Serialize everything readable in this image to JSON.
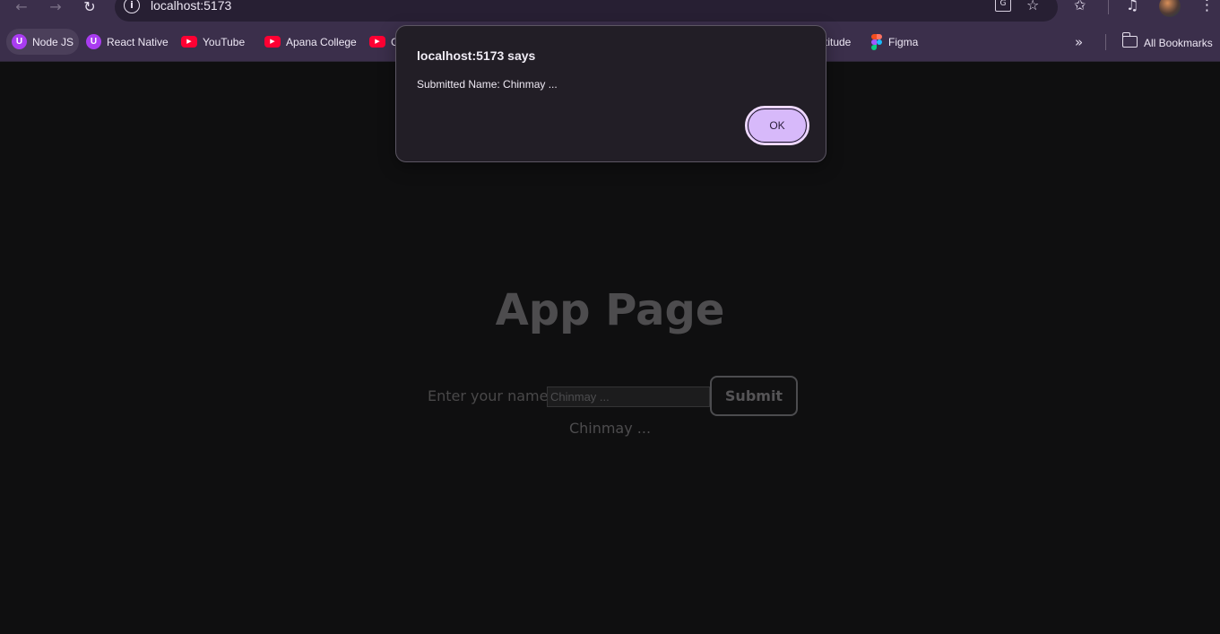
{
  "browser": {
    "url": "localhost:5173",
    "nav": {
      "back_icon": "←",
      "forward_icon": "→",
      "reload_icon": "↻"
    },
    "icons": {
      "site_info": "i",
      "translate": "G",
      "star": "☆",
      "side_star": "✩",
      "media": "♫",
      "menu": "⋮"
    }
  },
  "bookmarks": {
    "items": [
      {
        "label": "Node JS",
        "icon": "udemy-icon"
      },
      {
        "label": "React Native",
        "icon": "udemy-icon"
      },
      {
        "label": "YouTube",
        "icon": "youtube-icon"
      },
      {
        "label": "Apana College",
        "icon": "youtube-icon"
      },
      {
        "label": "C",
        "icon": "youtube-icon"
      },
      {
        "label": "titude",
        "icon": ""
      },
      {
        "label": "Figma",
        "icon": "figma-icon"
      }
    ],
    "overflow_icon": "»",
    "all_bookmarks_label": "All Bookmarks"
  },
  "dialog": {
    "title": "localhost:5173 says",
    "message": "Submitted Name: Chinmay ...",
    "ok_label": "OK"
  },
  "page": {
    "title": "App Page",
    "label": "Enter your name:",
    "input_value": "Chinmay ...",
    "submit_label": "Submit",
    "display_name": "Chinmay ..."
  }
}
